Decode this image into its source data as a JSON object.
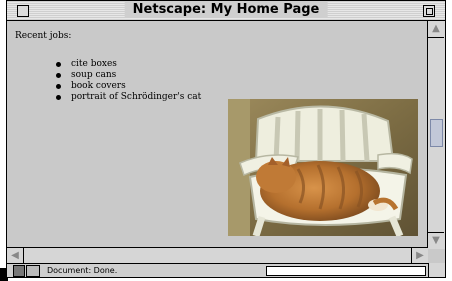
{
  "window": {
    "title": "Netscape: My Home Page"
  },
  "content": {
    "heading": "Recent jobs:",
    "items": [
      "cite boxes",
      "soup cans",
      "book covers",
      "portrait of Schrödinger's cat"
    ],
    "image": {
      "subject": "orange cat sleeping on white plastic lawn chair"
    }
  },
  "status": {
    "text": "Document: Done.",
    "progress": 0
  },
  "icons": {
    "close": "close-box-icon",
    "zoom": "zoom-box-icon",
    "scroll_up": "arrow-up-icon",
    "scroll_down": "arrow-down-icon",
    "scroll_left": "arrow-left-icon",
    "scroll_right": "arrow-right-icon",
    "status": "netscape-status-icon",
    "security": "broken-key-icon"
  },
  "colors": {
    "chrome": "#c9c9c9",
    "scroll_thumb": "#c2c8d8"
  }
}
